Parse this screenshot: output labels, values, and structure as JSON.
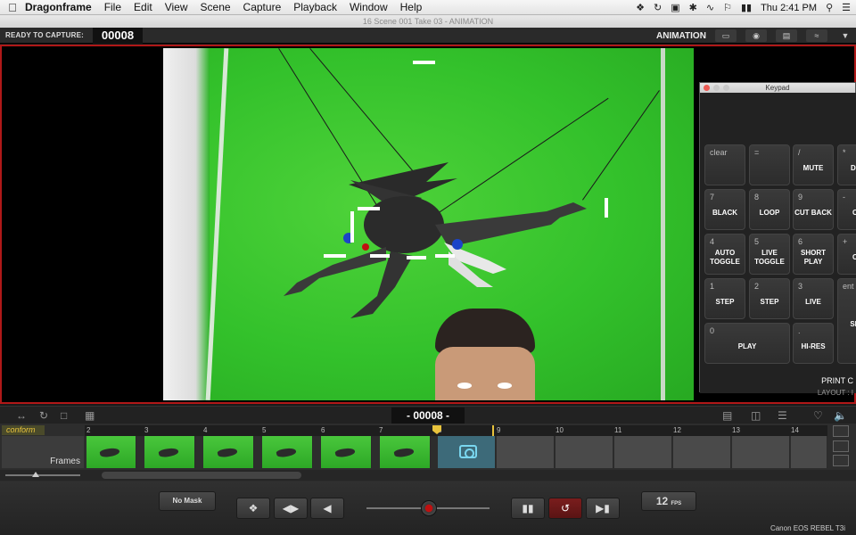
{
  "menubar": {
    "app_name": "Dragonframe",
    "items": [
      "File",
      "Edit",
      "View",
      "Scene",
      "Capture",
      "Playback",
      "Window",
      "Help"
    ],
    "clock": "Thu 2:41 PM"
  },
  "window": {
    "title": "16  Scene 001  Take 03 - ANIMATION"
  },
  "status": {
    "ready_label": "READY TO CAPTURE:",
    "frame_counter": "00008",
    "mode_label": "ANIMATION"
  },
  "keypad": {
    "title": "Keypad",
    "keys": [
      {
        "num": "clear",
        "label": ""
      },
      {
        "num": "=",
        "label": ""
      },
      {
        "num": "/",
        "label": "MUTE"
      },
      {
        "num": "*",
        "label": "DEL"
      },
      {
        "num": "7",
        "label": "BLACK"
      },
      {
        "num": "8",
        "label": "LOOP"
      },
      {
        "num": "9",
        "label": "CUT BACK"
      },
      {
        "num": "-",
        "label": "ON"
      },
      {
        "num": "4",
        "label": "AUTO TOGGLE"
      },
      {
        "num": "5",
        "label": "LIVE TOGGLE"
      },
      {
        "num": "6",
        "label": "SHORT PLAY"
      },
      {
        "num": "+",
        "label": "ON"
      },
      {
        "num": "1",
        "label": "STEP"
      },
      {
        "num": "2",
        "label": "STEP"
      },
      {
        "num": "3",
        "label": "LIVE"
      },
      {
        "num": "ent",
        "label": "SHO"
      },
      {
        "num": "0",
        "label": "PLAY"
      },
      {
        "num": ".",
        "label": "HI-RES"
      }
    ],
    "footer_print": "PRINT C",
    "footer_layout": "LAYOUT : I"
  },
  "timeline": {
    "frame_display": "- 00008 -",
    "conform_label": "conform",
    "track_label": "Frames",
    "ruler_ticks": [
      "2",
      "3",
      "4",
      "5",
      "6",
      "7",
      "8",
      "9",
      "10",
      "11",
      "12",
      "13",
      "14"
    ]
  },
  "controls": {
    "mask_label": "No Mask",
    "fps_value": "12",
    "fps_unit": "FPS",
    "camera_name": "Canon EOS REBEL T3i"
  },
  "colors": {
    "accent_red": "#b01818",
    "conform_yellow": "#e8c33c",
    "live_cyan": "#79d6ef"
  }
}
